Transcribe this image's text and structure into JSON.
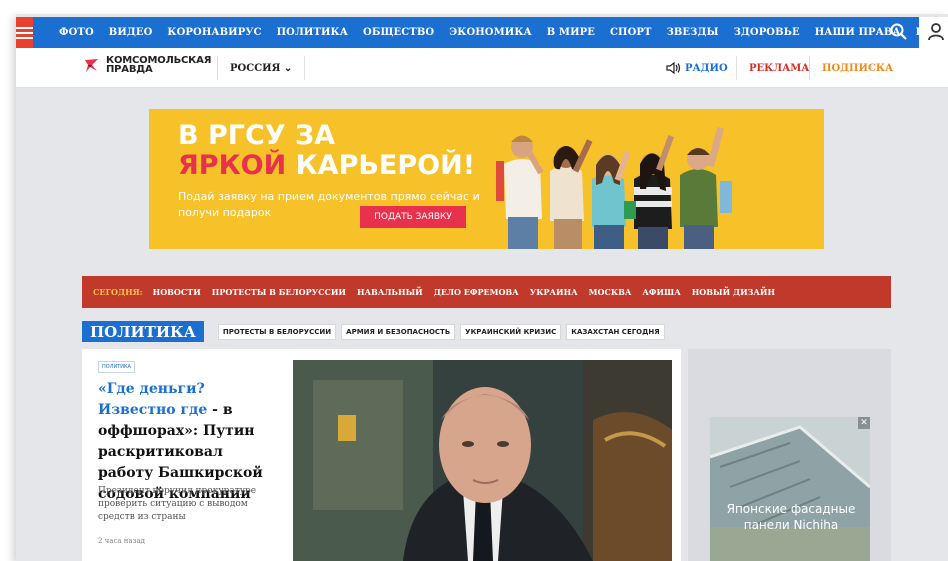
{
  "topnav": {
    "links": [
      "ФОТО",
      "ВИДЕО",
      "КОРОНАВИРУС",
      "ПОЛИТИКА",
      "ОБЩЕСТВО",
      "ЭКОНОМИКА",
      "В МИРЕ",
      "СПОРТ",
      "ЗВЕЗДЫ",
      "ЗДОРОВЬЕ",
      "НАШИ ПРАВА",
      "ЕЩЕ ⌄"
    ],
    "accent": "#1a6fd1",
    "menu_color": "#e84130"
  },
  "subhead": {
    "logo_line1": "КОМСОМОЛЬСКАЯ",
    "logo_line2": "ПРАВДА",
    "region": "РОССИЯ ⌄",
    "radio": "РАДИО",
    "ads": "РЕКЛАМА",
    "subscribe": "ПОДПИСКА"
  },
  "banner": {
    "line1": "В РГСУ ЗА",
    "line2_red": "ЯРКОЙ",
    "line2_white": " КАРЬЕРОЙ!",
    "subtitle": "Подай заявку на прием документов прямо сейчас и получи подарок",
    "cta": "ПОДАТЬ ЗАЯВКУ"
  },
  "trend": {
    "today": "СЕГОДНЯ:",
    "items": [
      "НОВОСТИ",
      "ПРОТЕСТЫ В БЕЛОРУССИИ",
      "НАВАЛЬНЫЙ",
      "ДЕЛО ЕФРЕМОВА",
      "УКРАИНА",
      "МОСКВА",
      "АФИША",
      "НОВЫЙ ДИЗАЙН"
    ]
  },
  "section": {
    "title": "ПОЛИТИКА",
    "tags": [
      "ПРОТЕСТЫ В БЕЛОРУССИИ",
      "АРМИЯ И БЕЗОПАСНОСТЬ",
      "УКРАИНСКИЙ КРИЗИС",
      "КАЗАХСТАН СЕГОДНЯ"
    ]
  },
  "article": {
    "rubric": "ПОЛИТИКА",
    "headline_blue": "«Где деньги? Известно где",
    "headline_rest": " - в оффшорах»: Путин раскритиковал работу Башкирской содовой компании",
    "lead": "Президент поручил прокуратуре проверить ситуацию с выводом средств из страны",
    "time": "2 часа назад"
  },
  "side_ad": {
    "close": "✕",
    "text": "Японские фасадные панели Nichiha"
  }
}
